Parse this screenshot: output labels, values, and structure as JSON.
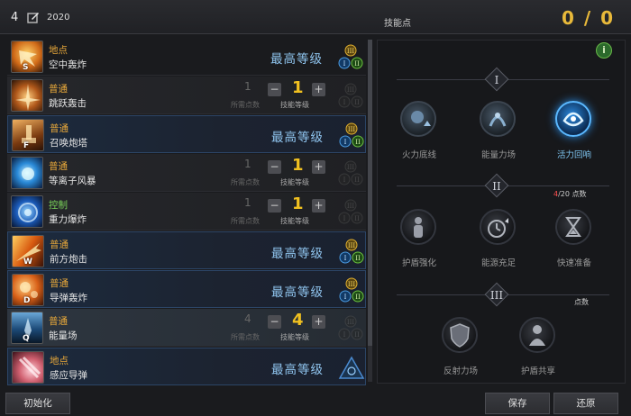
{
  "header": {
    "number": "4",
    "year": "2020",
    "skill_points_label": "技能点",
    "skill_points_value": "0 / 0"
  },
  "skills": [
    {
      "type": "地点",
      "type_color": "#e8a83a",
      "name": "空中轰炸",
      "key": "S",
      "mode": "max",
      "max_label": "最高等级",
      "style": "blue",
      "icon": "airstrike-icon"
    },
    {
      "type": "普通",
      "type_color": "#e8a83a",
      "name": "跳跃轰击",
      "key": "",
      "mode": "level",
      "required": "1",
      "required_label": "所需点数",
      "level": "1",
      "level_label": "技能等级",
      "style": "dark",
      "icon": "jump-strike-icon"
    },
    {
      "type": "普通",
      "type_color": "#e8a83a",
      "name": "召唤炮塔",
      "key": "F",
      "mode": "max",
      "max_label": "最高等级",
      "style": "blue",
      "icon": "turret-icon"
    },
    {
      "type": "普通",
      "type_color": "#e8a83a",
      "name": "等离子风暴",
      "key": "",
      "mode": "level",
      "required": "1",
      "required_label": "所需点数",
      "level": "1",
      "level_label": "技能等级",
      "style": "dark",
      "icon": "plasma-storm-icon"
    },
    {
      "type": "控制",
      "type_color": "#7ad45a",
      "name": "重力爆炸",
      "key": "",
      "mode": "level",
      "required": "1",
      "required_label": "所需点数",
      "level": "1",
      "level_label": "技能等级",
      "style": "dark",
      "icon": "gravity-icon"
    },
    {
      "type": "普通",
      "type_color": "#e8a83a",
      "name": "前方炮击",
      "key": "W",
      "mode": "max",
      "max_label": "最高等级",
      "style": "blue",
      "icon": "forward-cannon-icon"
    },
    {
      "type": "普通",
      "type_color": "#e8a83a",
      "name": "导弹轰炸",
      "key": "D",
      "mode": "max",
      "max_label": "最高等级",
      "style": "blue",
      "icon": "missile-barrage-icon"
    },
    {
      "type": "普通",
      "type_color": "#e8a83a",
      "name": "能量场",
      "key": "Q",
      "mode": "level",
      "required": "4",
      "required_label": "所需点数",
      "level": "4",
      "level_label": "技能等级",
      "style": "sel",
      "icon": "energy-field-icon"
    },
    {
      "type": "地点",
      "type_color": "#e8a83a",
      "name": "感应导弹",
      "key": "",
      "mode": "max",
      "max_label": "最高等级",
      "style": "blue",
      "icon": "homing-missile-icon"
    }
  ],
  "tree": {
    "tiers": [
      "I",
      "II",
      "III"
    ],
    "tier2_points": {
      "current": "4",
      "rest": "/20 点数"
    },
    "tier3_points": "点数",
    "nodes": [
      {
        "label": "火力底线",
        "active": false,
        "icon": "firepower-icon"
      },
      {
        "label": "能量力场",
        "active": false,
        "icon": "energy-force-icon"
      },
      {
        "label": "活力回响",
        "active": true,
        "icon": "vitality-echo-icon"
      },
      {
        "label": "护盾强化",
        "active": false,
        "icon": "shield-boost-icon"
      },
      {
        "label": "能源充足",
        "active": false,
        "icon": "stopwatch-icon"
      },
      {
        "label": "快速准备",
        "active": false,
        "icon": "hourglass-icon"
      },
      {
        "label": "反射力场",
        "active": false,
        "icon": "reflect-shield-icon"
      },
      {
        "label": "护盾共享",
        "active": false,
        "icon": "shield-share-icon"
      }
    ]
  },
  "buttons": {
    "init": "初始化",
    "save": "保存",
    "restore": "还原"
  },
  "colors": {
    "accent_gold": "#f0c020",
    "max_level_blue": "#8fc4ee",
    "active_node_blue": "#7fc6f2"
  }
}
